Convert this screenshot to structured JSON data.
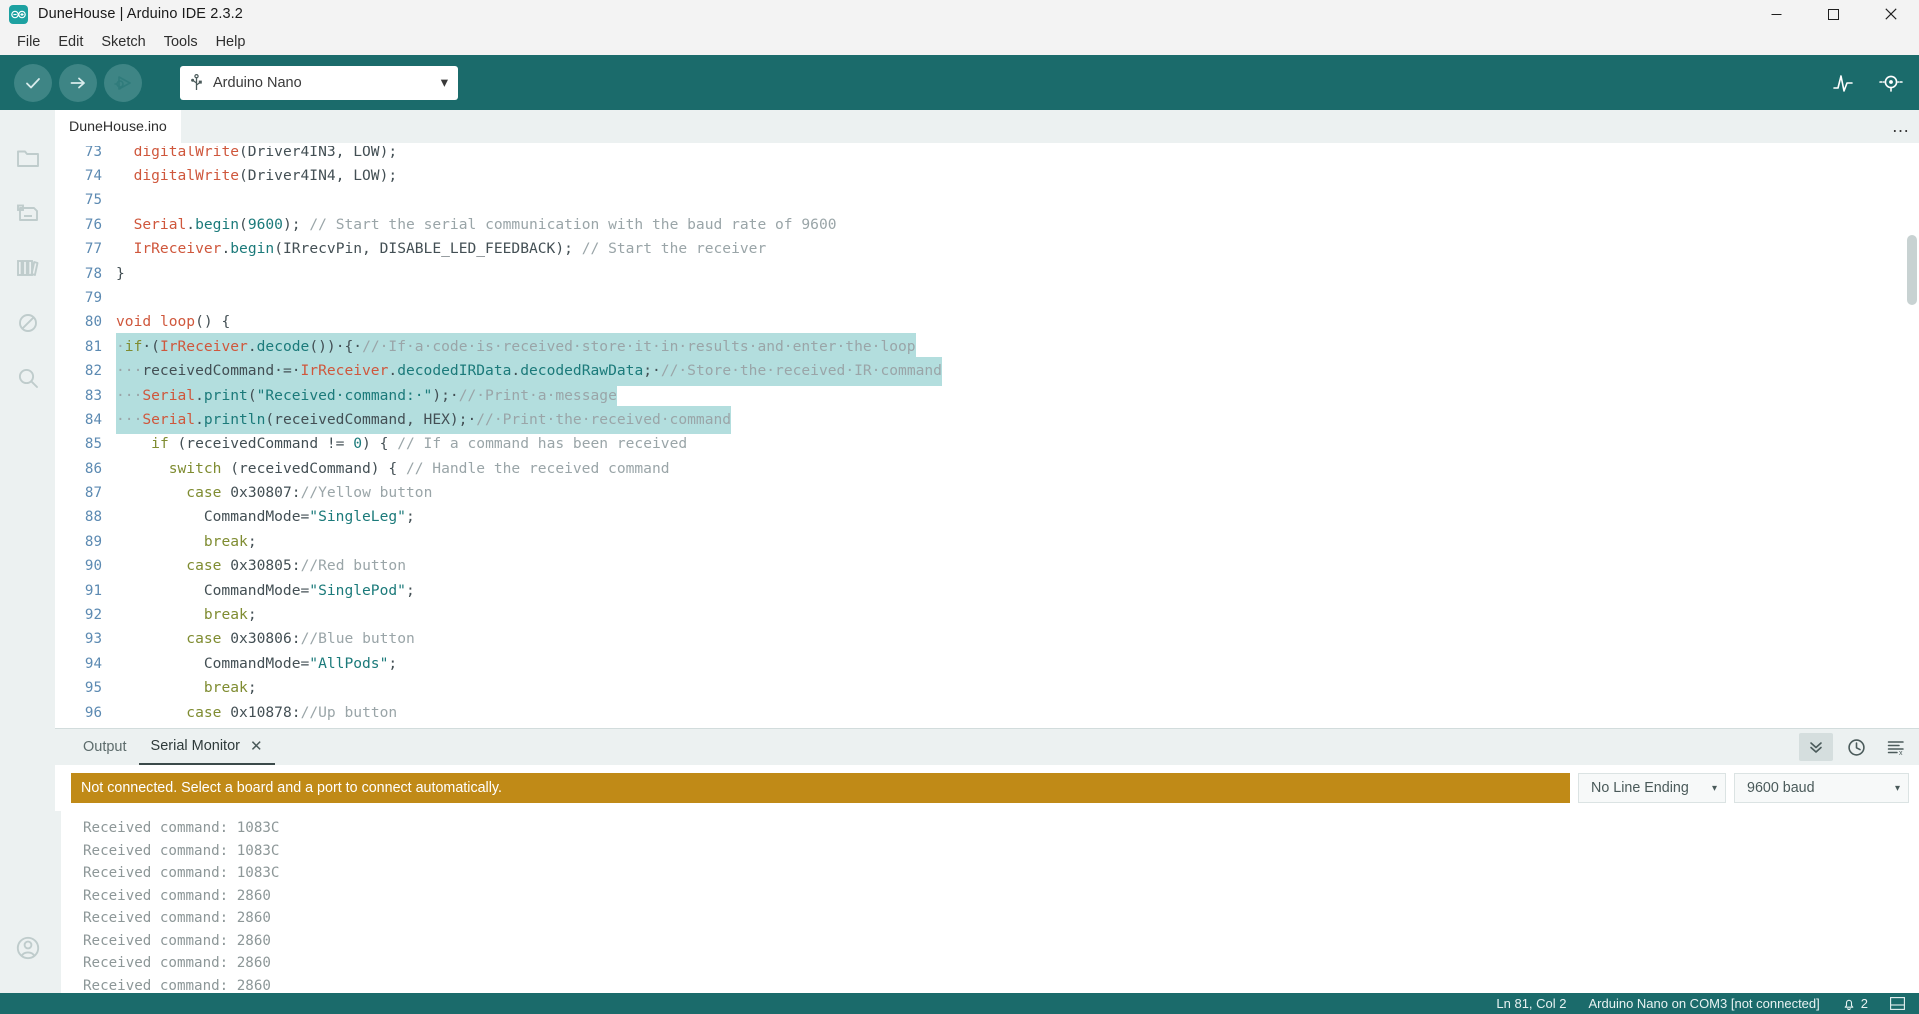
{
  "window": {
    "title": "DuneHouse | Arduino IDE 2.3.2",
    "logo_name": "arduino-logo",
    "minimize_label": "─",
    "maximize_label": "❐",
    "close_label": "✕"
  },
  "menubar": {
    "items": [
      {
        "label": "File"
      },
      {
        "label": "Edit"
      },
      {
        "label": "Sketch"
      },
      {
        "label": "Tools"
      },
      {
        "label": "Help"
      }
    ]
  },
  "toolbar": {
    "verify_title": "Verify",
    "upload_title": "Upload",
    "debug_title": "Debug",
    "board_selector": {
      "value": "Arduino Nano",
      "caret": "▾"
    },
    "serial_plotter_title": "Serial Plotter",
    "serial_monitor_title": "Serial Monitor"
  },
  "activitybar": {
    "items": [
      {
        "name": "sketchbook",
        "label": "Sketchbook"
      },
      {
        "name": "boards-manager",
        "label": "Boards Manager"
      },
      {
        "name": "library-manager",
        "label": "Library Manager"
      },
      {
        "name": "debug",
        "label": "Debug"
      },
      {
        "name": "search",
        "label": "Search"
      }
    ],
    "account_label": "Account"
  },
  "editor": {
    "tab": {
      "label": "DuneHouse.ino"
    },
    "more_label": "…",
    "first_line": 73,
    "lines": [
      {
        "n": 73,
        "clipped": true,
        "selected": false,
        "tokens": [
          {
            "t": "  ",
            "c": "pln"
          },
          {
            "t": "digitalWrite",
            "c": "fn"
          },
          {
            "t": "(Driver4IN3, LOW);",
            "c": "pln"
          }
        ]
      },
      {
        "n": 74,
        "selected": false,
        "tokens": [
          {
            "t": "  ",
            "c": "pln"
          },
          {
            "t": "digitalWrite",
            "c": "fn"
          },
          {
            "t": "(Driver4IN4, LOW);",
            "c": "pln"
          }
        ]
      },
      {
        "n": 75,
        "selected": false,
        "tokens": []
      },
      {
        "n": 76,
        "selected": false,
        "tokens": [
          {
            "t": "  ",
            "c": "pln"
          },
          {
            "t": "Serial",
            "c": "fn"
          },
          {
            "t": ".",
            "c": "pln"
          },
          {
            "t": "begin",
            "c": "mth"
          },
          {
            "t": "(",
            "c": "pln"
          },
          {
            "t": "9600",
            "c": "num"
          },
          {
            "t": "); ",
            "c": "pln"
          },
          {
            "t": "// Start the serial communication with the baud rate of 9600",
            "c": "cmt"
          }
        ]
      },
      {
        "n": 77,
        "selected": false,
        "tokens": [
          {
            "t": "  ",
            "c": "pln"
          },
          {
            "t": "IrReceiver",
            "c": "fn"
          },
          {
            "t": ".",
            "c": "pln"
          },
          {
            "t": "begin",
            "c": "mth"
          },
          {
            "t": "(IRrecvPin, DISABLE_LED_FEEDBACK); ",
            "c": "pln"
          },
          {
            "t": "// Start the receiver",
            "c": "cmt"
          }
        ]
      },
      {
        "n": 78,
        "selected": false,
        "tokens": [
          {
            "t": "}",
            "c": "pln"
          }
        ]
      },
      {
        "n": 79,
        "selected": false,
        "tokens": []
      },
      {
        "n": 80,
        "selected": false,
        "tokens": [
          {
            "t": "void",
            "c": "kw"
          },
          {
            "t": " ",
            "c": "pln"
          },
          {
            "t": "loop",
            "c": "fn"
          },
          {
            "t": "() {",
            "c": "pln"
          }
        ]
      },
      {
        "n": 81,
        "selected": true,
        "sel_width": 727,
        "tokens": [
          {
            "t": "·",
            "c": "cmt"
          },
          {
            "t": "if",
            "c": "kw2"
          },
          {
            "t": "·(",
            "c": "pln"
          },
          {
            "t": "IrReceiver",
            "c": "fn"
          },
          {
            "t": ".",
            "c": "pln"
          },
          {
            "t": "decode",
            "c": "mth"
          },
          {
            "t": "())·{·",
            "c": "pln"
          },
          {
            "t": "//·If·a·code·is·received·store·it·in·results·and·enter·the·loop",
            "c": "cmt"
          }
        ]
      },
      {
        "n": 82,
        "selected": true,
        "sel_width": 756,
        "tokens": [
          {
            "t": "···",
            "c": "cmt"
          },
          {
            "t": "receivedCommand·=·",
            "c": "pln"
          },
          {
            "t": "IrReceiver",
            "c": "fn"
          },
          {
            "t": ".",
            "c": "pln"
          },
          {
            "t": "decodedIRData",
            "c": "mth"
          },
          {
            "t": ".",
            "c": "pln"
          },
          {
            "t": "decodedRawData",
            "c": "mth"
          },
          {
            "t": ";·",
            "c": "pln"
          },
          {
            "t": "//·Store·the·received·IR·command",
            "c": "cmt"
          }
        ]
      },
      {
        "n": 83,
        "selected": true,
        "sel_width": 467,
        "tokens": [
          {
            "t": "···",
            "c": "cmt"
          },
          {
            "t": "Serial",
            "c": "fn"
          },
          {
            "t": ".",
            "c": "pln"
          },
          {
            "t": "print",
            "c": "mth"
          },
          {
            "t": "(",
            "c": "pln"
          },
          {
            "t": "\"Received·command:·\"",
            "c": "str"
          },
          {
            "t": ");·",
            "c": "pln"
          },
          {
            "t": "//·Print·a·message",
            "c": "cmt"
          }
        ]
      },
      {
        "n": 84,
        "selected": true,
        "sel_width": 561,
        "tokens": [
          {
            "t": "···",
            "c": "cmt"
          },
          {
            "t": "Serial",
            "c": "fn"
          },
          {
            "t": ".",
            "c": "pln"
          },
          {
            "t": "println",
            "c": "mth"
          },
          {
            "t": "(receivedCommand, HEX);·",
            "c": "pln"
          },
          {
            "t": "//·Print·the·received·command",
            "c": "cmt"
          }
        ]
      },
      {
        "n": 85,
        "selected": false,
        "tokens": [
          {
            "t": "    ",
            "c": "pln"
          },
          {
            "t": "if",
            "c": "kw2"
          },
          {
            "t": " (receivedCommand != ",
            "c": "pln"
          },
          {
            "t": "0",
            "c": "num"
          },
          {
            "t": ") { ",
            "c": "pln"
          },
          {
            "t": "// If a command has been received",
            "c": "cmt"
          }
        ]
      },
      {
        "n": 86,
        "selected": false,
        "tokens": [
          {
            "t": "      ",
            "c": "pln"
          },
          {
            "t": "switch",
            "c": "kw2"
          },
          {
            "t": " (receivedCommand) { ",
            "c": "pln"
          },
          {
            "t": "// Handle the received command",
            "c": "cmt"
          }
        ]
      },
      {
        "n": 87,
        "selected": false,
        "tokens": [
          {
            "t": "        ",
            "c": "pln"
          },
          {
            "t": "case",
            "c": "kw2"
          },
          {
            "t": " ",
            "c": "pln"
          },
          {
            "t": "0x30807",
            "c": "pln"
          },
          {
            "t": ":",
            "c": "pln"
          },
          {
            "t": "//Yellow button",
            "c": "cmt"
          }
        ]
      },
      {
        "n": 88,
        "selected": false,
        "tokens": [
          {
            "t": "          CommandMode=",
            "c": "pln"
          },
          {
            "t": "\"SingleLeg\"",
            "c": "str"
          },
          {
            "t": ";",
            "c": "pln"
          }
        ]
      },
      {
        "n": 89,
        "selected": false,
        "tokens": [
          {
            "t": "          ",
            "c": "pln"
          },
          {
            "t": "break",
            "c": "kw2"
          },
          {
            "t": ";",
            "c": "pln"
          }
        ]
      },
      {
        "n": 90,
        "selected": false,
        "tokens": [
          {
            "t": "        ",
            "c": "pln"
          },
          {
            "t": "case",
            "c": "kw2"
          },
          {
            "t": " ",
            "c": "pln"
          },
          {
            "t": "0x30805",
            "c": "pln"
          },
          {
            "t": ":",
            "c": "pln"
          },
          {
            "t": "//Red button",
            "c": "cmt"
          }
        ]
      },
      {
        "n": 91,
        "selected": false,
        "tokens": [
          {
            "t": "          CommandMode=",
            "c": "pln"
          },
          {
            "t": "\"SinglePod\"",
            "c": "str"
          },
          {
            "t": ";",
            "c": "pln"
          }
        ]
      },
      {
        "n": 92,
        "selected": false,
        "tokens": [
          {
            "t": "          ",
            "c": "pln"
          },
          {
            "t": "break",
            "c": "kw2"
          },
          {
            "t": ";",
            "c": "pln"
          }
        ]
      },
      {
        "n": 93,
        "selected": false,
        "tokens": [
          {
            "t": "        ",
            "c": "pln"
          },
          {
            "t": "case",
            "c": "kw2"
          },
          {
            "t": " ",
            "c": "pln"
          },
          {
            "t": "0x30806",
            "c": "pln"
          },
          {
            "t": ":",
            "c": "pln"
          },
          {
            "t": "//Blue button",
            "c": "cmt"
          }
        ]
      },
      {
        "n": 94,
        "selected": false,
        "tokens": [
          {
            "t": "          CommandMode=",
            "c": "pln"
          },
          {
            "t": "\"AllPods\"",
            "c": "str"
          },
          {
            "t": ";",
            "c": "pln"
          }
        ]
      },
      {
        "n": 95,
        "selected": false,
        "tokens": [
          {
            "t": "          ",
            "c": "pln"
          },
          {
            "t": "break",
            "c": "kw2"
          },
          {
            "t": ";",
            "c": "pln"
          }
        ]
      },
      {
        "n": 96,
        "selected": false,
        "tokens": [
          {
            "t": "        ",
            "c": "pln"
          },
          {
            "t": "case",
            "c": "kw2"
          },
          {
            "t": " ",
            "c": "pln"
          },
          {
            "t": "0x10878",
            "c": "pln"
          },
          {
            "t": ":",
            "c": "pln"
          },
          {
            "t": "//Up button",
            "c": "cmt"
          }
        ]
      }
    ]
  },
  "panel": {
    "tabs": [
      {
        "label": "Output",
        "active": false,
        "closable": false
      },
      {
        "label": "Serial Monitor",
        "active": true,
        "closable": true,
        "close_label": "✕"
      }
    ],
    "actions": [
      {
        "name": "scroll-to-bottom",
        "glyph": "»",
        "pressed": true
      },
      {
        "name": "timestamp",
        "glyph": "clock",
        "pressed": false
      },
      {
        "name": "clear-output",
        "glyph": "clear",
        "pressed": false
      }
    ],
    "notice": "Not connected. Select a board and a port to connect automatically.",
    "line_ending": {
      "value": "No Line Ending",
      "caret": "▾"
    },
    "baud_rate": {
      "value": "9600 baud",
      "caret": "▾"
    },
    "output_lines": [
      "Received command: 1083C",
      "Received command: 1083C",
      "Received command: 1083C",
      "Received command: 2860",
      "Received command: 2860",
      "Received command: 2860",
      "Received command: 2860",
      "Received command: 2860"
    ]
  },
  "statusbar": {
    "cursor_position": "Ln 81, Col 2",
    "board_status": "Arduino Nano on COM3 [not connected]",
    "notification_count": "2",
    "toggle_panel_title": "Toggle Bottom Panel"
  },
  "colors": {
    "accent_teal": "#1b6b6b",
    "warning_gold": "#c08a17",
    "selection": "#b3dede",
    "chrome_light": "#ecf1f1"
  }
}
